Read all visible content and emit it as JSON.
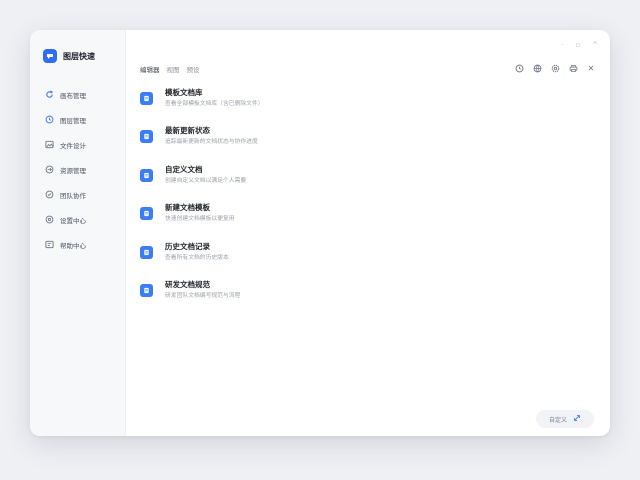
{
  "app": {
    "name": "图层快速",
    "brand_color": "#2f6df6"
  },
  "window_controls": [
    "·",
    "▫",
    "^"
  ],
  "sidebar": {
    "items": [
      {
        "label": "画布管理",
        "icon": "refresh-icon"
      },
      {
        "label": "图层管理",
        "icon": "clock-icon"
      },
      {
        "label": "文件设计",
        "icon": "image-icon"
      },
      {
        "label": "资源管理",
        "icon": "share-icon"
      },
      {
        "label": "团队协作",
        "icon": "check-circle-icon"
      },
      {
        "label": "设置中心",
        "icon": "settings-icon"
      },
      {
        "label": "帮助中心",
        "icon": "help-icon"
      }
    ]
  },
  "tabs": [
    {
      "label": "编辑器",
      "active": true
    },
    {
      "label": "视图",
      "active": false
    },
    {
      "label": "预设",
      "active": false
    }
  ],
  "toolbar": {
    "icons": [
      "clock-icon",
      "globe-icon",
      "gear-icon",
      "printer-icon",
      "close-icon"
    ],
    "close_glyph": "✕"
  },
  "list": [
    {
      "title": "模板文档库",
      "subtitle": "查看全部模板文档库（含已删除文件）",
      "icon": "file-icon"
    },
    {
      "title": "最新更新状态",
      "subtitle": "追踪最新更新的文档状态与协作进度",
      "icon": "file-icon"
    },
    {
      "title": "自定义文档",
      "subtitle": "创建自定义文档以满足个人需要",
      "icon": "file-icon"
    },
    {
      "title": "新建文档模板",
      "subtitle": "快速创建文档模板以便复用",
      "icon": "file-icon"
    },
    {
      "title": "历史文档记录",
      "subtitle": "查看所有文档的历史版本",
      "icon": "file-icon"
    },
    {
      "title": "研发文档规范",
      "subtitle": "研发团队文档编写规范与流程",
      "icon": "file-icon"
    }
  ],
  "footer": {
    "button_label": "自定义",
    "icon": "expand-icon"
  }
}
